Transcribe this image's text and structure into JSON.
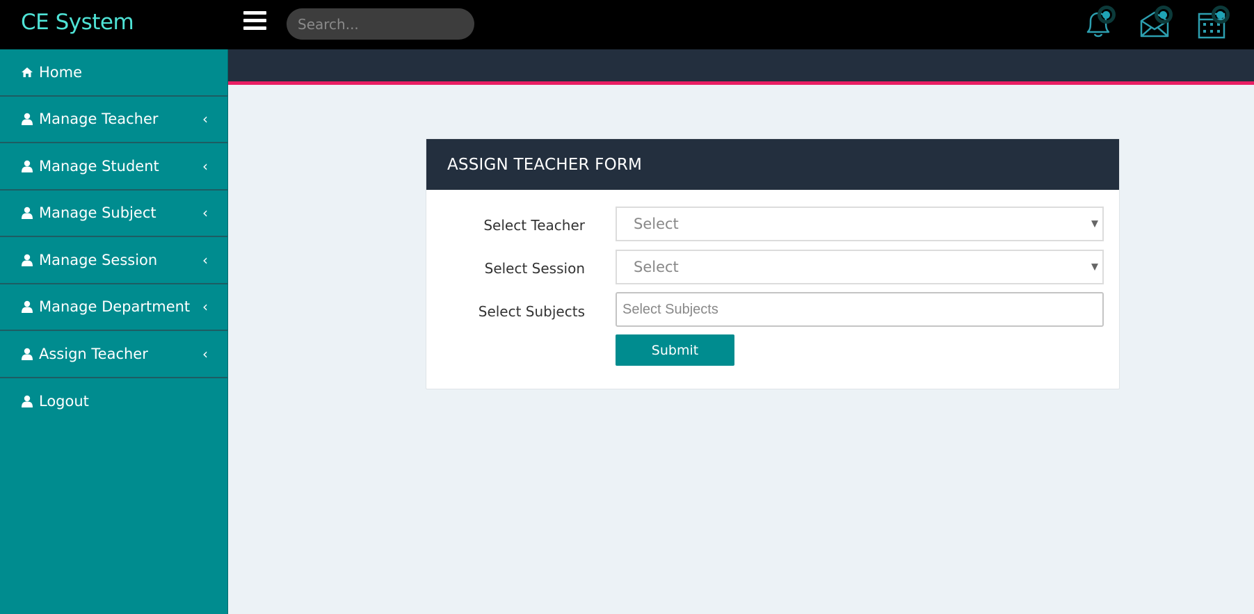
{
  "app": {
    "brand": "CE System"
  },
  "topbar": {
    "search_placeholder": "Search...",
    "icons": [
      "bell-icon",
      "mail-icon",
      "calendar-icon"
    ]
  },
  "sidebar": {
    "items": [
      {
        "label": "Home",
        "icon": "home-icon",
        "has_chevron": false
      },
      {
        "label": "Manage Teacher",
        "icon": "user-icon",
        "has_chevron": true
      },
      {
        "label": "Manage Student",
        "icon": "user-icon",
        "has_chevron": true
      },
      {
        "label": "Manage Subject",
        "icon": "user-icon",
        "has_chevron": true
      },
      {
        "label": "Manage Session",
        "icon": "user-icon",
        "has_chevron": true
      },
      {
        "label": "Manage Department",
        "icon": "user-icon",
        "has_chevron": true
      },
      {
        "label": "Assign Teacher",
        "icon": "user-icon",
        "has_chevron": true
      },
      {
        "label": "Logout",
        "icon": "user-icon",
        "has_chevron": false
      }
    ]
  },
  "form": {
    "title": "ASSIGN TEACHER FORM",
    "teacher_label": "Select Teacher",
    "teacher_value": "Select",
    "session_label": "Select Session",
    "session_value": "Select",
    "subjects_label": "Select Subjects",
    "subjects_placeholder": "Select Subjects",
    "submit_label": "Submit"
  },
  "colors": {
    "brand": "#4fe3d6",
    "sidebar": "#008c8f",
    "header_dark": "#232f3e",
    "accent_line": "#e81e63",
    "button": "#008c8f"
  }
}
